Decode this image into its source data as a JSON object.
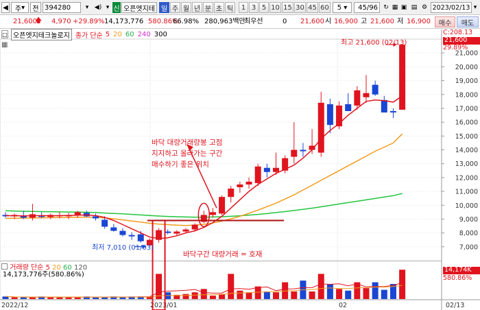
{
  "toolbar": {
    "btn_left": "주",
    "btn_jeon": "전",
    "code": "394280",
    "name_prefix": "신",
    "stock_name": "오픈엣지테",
    "periods": [
      "일",
      "주",
      "월",
      "년",
      "분",
      "초",
      "틱"
    ],
    "minutes": [
      "1",
      "3",
      "5",
      "10",
      "15",
      "30",
      "45",
      "60",
      "5"
    ],
    "page": "45/96",
    "date": "2023/02/13"
  },
  "quote": {
    "price": "21,600",
    "change": "4,970",
    "rate": "+29.89%",
    "volume": "14,173,776",
    "vol_rate": "580.86%",
    "ratio": "66.98%",
    "amount": "280,963백만",
    "ts_label": "최우선",
    "ts_value": "0",
    "ask": "21,600",
    "open_label": "시",
    "open": "16,900",
    "high_label": "고",
    "high": "21,600",
    "low_label": "저",
    "low": "16,900",
    "buy_btn": "매수",
    "sell_btn": "매도"
  },
  "legend": {
    "title": "오픈엣지테크놀로지",
    "price_label": "종가 단순",
    "ma": [
      "5",
      "20",
      "60",
      "240",
      "300"
    ]
  },
  "vol_legend": {
    "title": "거래량 단순",
    "ma": [
      "5",
      "20",
      "60",
      "120"
    ],
    "value": "14,173,776주(580.86%)"
  },
  "annotations": {
    "high_label": "최고 21,600 (02/13)",
    "low_label": "최저 7,010 (01/03)",
    "note_lines": [
      "바닥 대량거래량봉 고점",
      "지지하고 올라가는 구간",
      "매수하기 좋은 위치"
    ],
    "bottom_note": "바닥구간 대량거래 = 호재",
    "right_top": "C:208.13",
    "price_tag": "21,600",
    "rate_tag": "29.89%",
    "vol_tag": "14,174K",
    "vol_rate_tag": "580.86%"
  },
  "chart_data": {
    "type": "candlestick",
    "ylim": [
      6000,
      22000
    ],
    "y_ticks": [
      7000,
      8000,
      9000,
      10000,
      11000,
      12000,
      13000,
      14000,
      15000,
      16000,
      17000,
      18000,
      19000,
      20000,
      21000
    ],
    "y_tick_labels": [
      "7,000",
      "8,000",
      "9,000",
      "10,000",
      "11,000",
      "12,000",
      "13,000",
      "14,000",
      "15,000",
      "16,000",
      "17,000",
      "18,000",
      "19,000",
      "20,000",
      "21,000"
    ],
    "x_labels": [
      "2022/12",
      "2023/01",
      "02",
      "02/13"
    ],
    "candles": [
      {
        "o": 9300,
        "h": 9500,
        "l": 9100,
        "c": 9200
      },
      {
        "o": 9200,
        "h": 9400,
        "l": 9000,
        "c": 9300
      },
      {
        "o": 9250,
        "h": 9600,
        "l": 9000,
        "c": 9100
      },
      {
        "o": 9100,
        "h": 10100,
        "l": 8900,
        "c": 9350
      },
      {
        "o": 9250,
        "h": 9500,
        "l": 9050,
        "c": 9150
      },
      {
        "o": 9150,
        "h": 9400,
        "l": 9000,
        "c": 9300
      },
      {
        "o": 9200,
        "h": 9500,
        "l": 9050,
        "c": 9250
      },
      {
        "o": 9200,
        "h": 9450,
        "l": 9000,
        "c": 9300
      },
      {
        "o": 9250,
        "h": 9600,
        "l": 9100,
        "c": 9500
      },
      {
        "o": 9450,
        "h": 9600,
        "l": 9150,
        "c": 9200
      },
      {
        "o": 9200,
        "h": 9400,
        "l": 8900,
        "c": 9050
      },
      {
        "o": 8950,
        "h": 9200,
        "l": 8300,
        "c": 8450
      },
      {
        "o": 8400,
        "h": 8650,
        "l": 8100,
        "c": 8150
      },
      {
        "o": 8150,
        "h": 8350,
        "l": 7750,
        "c": 7850
      },
      {
        "o": 7850,
        "h": 8050,
        "l": 7500,
        "c": 7750
      },
      {
        "o": 7900,
        "h": 8150,
        "l": 7300,
        "c": 7400
      },
      {
        "o": 7100,
        "h": 7600,
        "l": 7010,
        "c": 7500
      },
      {
        "o": 7500,
        "h": 8350,
        "l": 7300,
        "c": 8200
      },
      {
        "o": 8100,
        "h": 8250,
        "l": 7900,
        "c": 8000
      },
      {
        "o": 7950,
        "h": 8200,
        "l": 7800,
        "c": 8100
      },
      {
        "o": 8100,
        "h": 8350,
        "l": 8000,
        "c": 8250
      },
      {
        "o": 8250,
        "h": 8700,
        "l": 8100,
        "c": 8600
      },
      {
        "o": 8800,
        "h": 9600,
        "l": 8700,
        "c": 9300
      },
      {
        "o": 9300,
        "h": 9800,
        "l": 9100,
        "c": 9500
      },
      {
        "o": 9400,
        "h": 10700,
        "l": 9300,
        "c": 10600
      },
      {
        "o": 10600,
        "h": 11400,
        "l": 10200,
        "c": 11200
      },
      {
        "o": 11300,
        "h": 11700,
        "l": 10900,
        "c": 11500
      },
      {
        "o": 11500,
        "h": 12000,
        "l": 11200,
        "c": 11700
      },
      {
        "o": 11600,
        "h": 13000,
        "l": 11400,
        "c": 12800
      },
      {
        "o": 12700,
        "h": 13000,
        "l": 12000,
        "c": 12400
      },
      {
        "o": 12400,
        "h": 13800,
        "l": 12200,
        "c": 12700
      },
      {
        "o": 12500,
        "h": 13600,
        "l": 12300,
        "c": 13400
      },
      {
        "o": 13500,
        "h": 16000,
        "l": 13000,
        "c": 14000
      },
      {
        "o": 14000,
        "h": 14500,
        "l": 13500,
        "c": 13900
      },
      {
        "o": 14000,
        "h": 15500,
        "l": 13700,
        "c": 14300
      },
      {
        "o": 13800,
        "h": 18200,
        "l": 13500,
        "c": 17400
      },
      {
        "o": 17300,
        "h": 17700,
        "l": 15200,
        "c": 15800
      },
      {
        "o": 15700,
        "h": 17500,
        "l": 15500,
        "c": 17200
      },
      {
        "o": 17300,
        "h": 18100,
        "l": 16900,
        "c": 16800
      },
      {
        "o": 17200,
        "h": 18600,
        "l": 16900,
        "c": 18300
      },
      {
        "o": 17800,
        "h": 19400,
        "l": 17400,
        "c": 18100
      },
      {
        "o": 18700,
        "h": 19000,
        "l": 17900,
        "c": 18000
      },
      {
        "o": 17600,
        "h": 17900,
        "l": 16800,
        "c": 16700
      },
      {
        "o": 16800,
        "h": 17000,
        "l": 16300,
        "c": 16700
      },
      {
        "o": 16900,
        "h": 21600,
        "l": 16900,
        "c": 21600
      }
    ],
    "volume": [
      3,
      2,
      2,
      2,
      3,
      2,
      2,
      2,
      2,
      3,
      2,
      2,
      3,
      2,
      3,
      3,
      3,
      30,
      8,
      5,
      6,
      8,
      12,
      4,
      6,
      30,
      10,
      8,
      15,
      9,
      8,
      20,
      9,
      22,
      9,
      30,
      18,
      12,
      10,
      20,
      13,
      20,
      11,
      18,
      35
    ],
    "vol_ylim": [
      0,
      36
    ],
    "ma5": [
      9250,
      9240,
      9230,
      9240,
      9250,
      9240,
      9250,
      9260,
      9280,
      9300,
      9250,
      9120,
      8900,
      8600,
      8300,
      8000,
      7700,
      7600,
      7650,
      7800,
      8000,
      8150,
      8400,
      8750,
      9200,
      9800,
      10400,
      11000,
      11500,
      11900,
      12300,
      12600,
      12900,
      13400,
      14000,
      14800,
      15400,
      15900,
      16500,
      17000,
      17500,
      17600,
      17550,
      17450,
      17900
    ],
    "ma20": [
      9050,
      9060,
      9070,
      9080,
      9090,
      9100,
      9110,
      9120,
      9130,
      9140,
      9120,
      9080,
      9020,
      8940,
      8860,
      8780,
      8700,
      8640,
      8600,
      8560,
      8540,
      8560,
      8620,
      8720,
      8860,
      9020,
      9200,
      9420,
      9650,
      9900,
      10150,
      10450,
      10750,
      11100,
      11450,
      11800,
      12150,
      12500,
      12850,
      13200,
      13550,
      13900,
      14200,
      14500,
      15150
    ],
    "ma60": [
      9600,
      9580,
      9560,
      9550,
      9540,
      9530,
      9520,
      9510,
      9500,
      9490,
      9470,
      9440,
      9410,
      9380,
      9340,
      9300,
      9260,
      9220,
      9190,
      9170,
      9150,
      9140,
      9140,
      9150,
      9170,
      9200,
      9240,
      9290,
      9340,
      9400,
      9470,
      9540,
      9620,
      9700,
      9790,
      9890,
      9990,
      10090,
      10190,
      10290,
      10390,
      10490,
      10590,
      10690,
      10850
    ]
  }
}
